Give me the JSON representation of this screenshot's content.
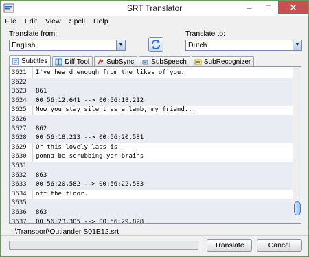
{
  "window": {
    "title": "SRT Translator"
  },
  "menu": [
    "File",
    "Edit",
    "View",
    "Spell",
    "Help"
  ],
  "translate_from": {
    "label": "Translate from:",
    "value": "English"
  },
  "translate_to": {
    "label": "Translate to:",
    "value": "Dutch"
  },
  "tabs": [
    {
      "label": "Subtitles",
      "icon": "subtitles-icon",
      "color": "#3a6fb0"
    },
    {
      "label": "Diff Tool",
      "icon": "diff-icon",
      "color": "#2a7fd0"
    },
    {
      "label": "SubSync",
      "icon": "sync-icon",
      "color": "#c03030"
    },
    {
      "label": "SubSpeech",
      "icon": "speech-icon",
      "color": "#5a7aa0"
    },
    {
      "label": "SubRecognizer",
      "icon": "recognizer-icon",
      "color": "#c09a20"
    }
  ],
  "lines": [
    {
      "n": "3621",
      "t": "I've heard enough from the likes of you.",
      "shade": false
    },
    {
      "n": "3622",
      "t": "",
      "shade": true
    },
    {
      "n": "3623",
      "t": "861",
      "shade": true
    },
    {
      "n": "3624",
      "t": "00:56:12,641 --> 00:56:18,212",
      "shade": true
    },
    {
      "n": "3625",
      "t": "Now you stay silent as a lamb, my friend...",
      "shade": false
    },
    {
      "n": "3626",
      "t": "",
      "shade": true
    },
    {
      "n": "3627",
      "t": "862",
      "shade": true
    },
    {
      "n": "3628",
      "t": "00:56:18,213 --> 00:56:20,581",
      "shade": true
    },
    {
      "n": "3629",
      "t": "Or this lovely lass is",
      "shade": false
    },
    {
      "n": "3630",
      "t": "gonna be scrubbing yer brains",
      "shade": false
    },
    {
      "n": "3631",
      "t": "",
      "shade": true
    },
    {
      "n": "3632",
      "t": "863",
      "shade": true
    },
    {
      "n": "3633",
      "t": "00:56:20,582 --> 00:56:22,583",
      "shade": true
    },
    {
      "n": "3634",
      "t": "off the floor.",
      "shade": false
    },
    {
      "n": "3635",
      "t": "",
      "shade": true
    },
    {
      "n": "3636",
      "t": "863",
      "shade": true
    },
    {
      "n": "3637",
      "t": "00:56:23,305 --> 00:56:29,828",
      "shade": true
    }
  ],
  "file_path": "I:\\Transport\\Outlander S01E12.srt",
  "buttons": {
    "translate": "Translate",
    "cancel": "Cancel"
  },
  "colors": {
    "titlebar_close": "#c75050",
    "shade_row": "#e9ecf2",
    "desktop": "#5b9e47"
  }
}
